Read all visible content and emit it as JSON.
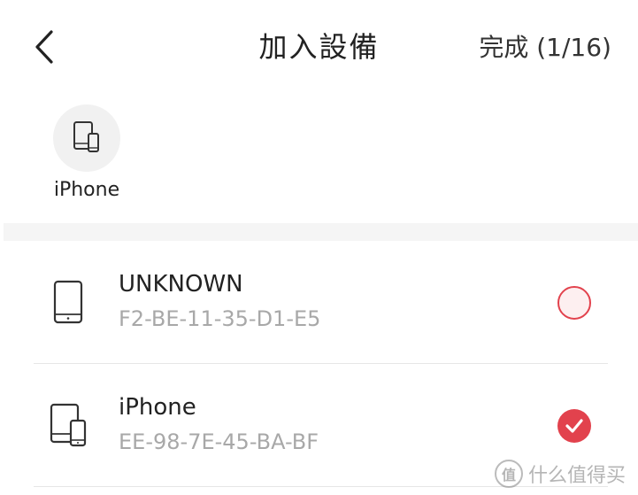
{
  "header": {
    "title": "加入設備",
    "done_label": "完成 (1/16)"
  },
  "selected": {
    "items": [
      {
        "label": "iPhone",
        "icon": "tablet-phone-icon"
      }
    ]
  },
  "devices": [
    {
      "name": "UNKNOWN",
      "mac": "F2-BE-11-35-D1-E5",
      "icon": "phone-icon",
      "selected": false
    },
    {
      "name": "iPhone",
      "mac": "EE-98-7E-45-BA-BF",
      "icon": "tablet-phone-icon",
      "selected": true
    }
  ],
  "watermark": {
    "badge": "值",
    "text": "什么值得买"
  },
  "colors": {
    "accent": "#e2424d",
    "radio_unchecked_fill": "#fdeff0",
    "secondary_text": "#a8a8a8"
  }
}
